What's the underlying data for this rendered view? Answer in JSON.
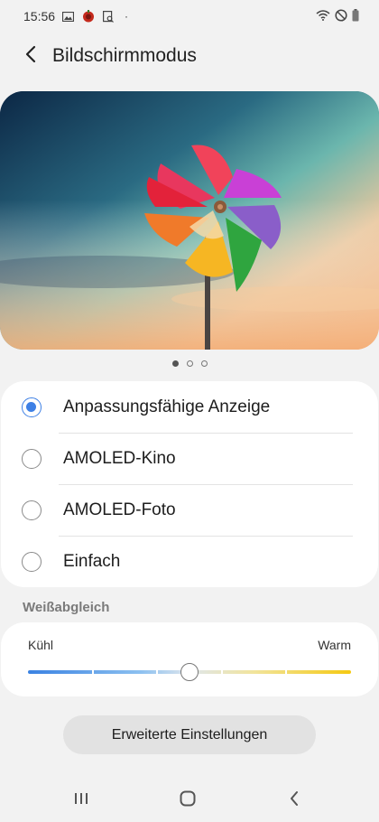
{
  "status_bar": {
    "time": "15:56",
    "dot": "·",
    "icons": [
      "gallery-icon",
      "app-notification-icon",
      "screenshot-icon",
      "wifi-icon",
      "do-not-disturb-icon",
      "battery-icon"
    ]
  },
  "header": {
    "title": "Bildschirmmodus",
    "back_icon": "back-arrow-icon"
  },
  "preview": {
    "page_count": 3,
    "active_page": 1
  },
  "modes": {
    "selected_index": 0,
    "options": [
      {
        "label": "Anpassungsfähige Anzeige",
        "selected": true
      },
      {
        "label": "AMOLED-Kino",
        "selected": false
      },
      {
        "label": "AMOLED-Foto",
        "selected": false
      },
      {
        "label": "Einfach",
        "selected": false
      }
    ]
  },
  "white_balance": {
    "title": "Weißabgleich",
    "cool_label": "Kühl",
    "warm_label": "Warm",
    "value_fraction": 0.5,
    "steps": 5
  },
  "advanced_button": {
    "label": "Erweiterte Einstellungen"
  },
  "navigation": {
    "recent_icon": "recent-apps-icon",
    "home_icon": "home-icon",
    "back_icon": "back-icon"
  },
  "colors": {
    "accent": "#3e80e5",
    "cool": "#3a82e2",
    "warm": "#f5c912",
    "background": "#f2f2f2"
  }
}
